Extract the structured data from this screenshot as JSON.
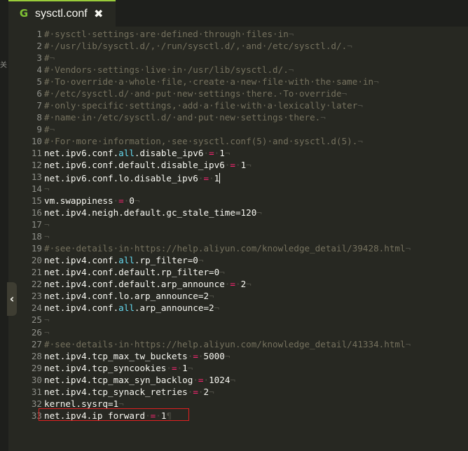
{
  "tab": {
    "title": "sysctl.conf",
    "icon": "G",
    "close": "✖"
  },
  "side_glyph": "关",
  "collapse_glyph": "‹",
  "colors": {
    "background": "#272822",
    "comment": "#75715e",
    "keyword": "#66d9ef",
    "operator": "#f92672",
    "text": "#f8f8f2",
    "highlight_border": "#e02020"
  },
  "lines": [
    {
      "n": "1",
      "tokens": [
        [
          "comment",
          "#·sysctl·settings·are·defined·through·files·in"
        ],
        [
          "ws",
          "¬"
        ]
      ]
    },
    {
      "n": "2",
      "tokens": [
        [
          "comment",
          "#·/usr/lib/sysctl.d/,·/run/sysctl.d/,·and·/etc/sysctl.d/."
        ],
        [
          "ws",
          "¬"
        ]
      ]
    },
    {
      "n": "3",
      "tokens": [
        [
          "comment",
          "#"
        ],
        [
          "ws",
          "¬"
        ]
      ]
    },
    {
      "n": "4",
      "tokens": [
        [
          "comment",
          "#·Vendors·settings·live·in·/usr/lib/sysctl.d/."
        ],
        [
          "ws",
          "¬"
        ]
      ]
    },
    {
      "n": "5",
      "tokens": [
        [
          "comment",
          "#·To·override·a·whole·file,·create·a·new·file·with·the·same·in"
        ],
        [
          "ws",
          "¬"
        ]
      ]
    },
    {
      "n": "6",
      "tokens": [
        [
          "comment",
          "#·/etc/sysctl.d/·and·put·new·settings·there.·To·override"
        ],
        [
          "ws",
          "¬"
        ]
      ]
    },
    {
      "n": "7",
      "tokens": [
        [
          "comment",
          "#·only·specific·settings,·add·a·file·with·a·lexically·later"
        ],
        [
          "ws",
          "¬"
        ]
      ]
    },
    {
      "n": "8",
      "tokens": [
        [
          "comment",
          "#·name·in·/etc/sysctl.d/·and·put·new·settings·there."
        ],
        [
          "ws",
          "¬"
        ]
      ]
    },
    {
      "n": "9",
      "tokens": [
        [
          "comment",
          "#"
        ],
        [
          "ws",
          "¬"
        ]
      ]
    },
    {
      "n": "10",
      "tokens": [
        [
          "comment",
          "#·For·more·information,·see·sysctl.conf(5)·and·sysctl.d(5)."
        ],
        [
          "ws",
          "¬"
        ]
      ]
    },
    {
      "n": "11",
      "tokens": [
        [
          "key",
          "net.ipv6.conf."
        ],
        [
          "kw",
          "all"
        ],
        [
          "key",
          ".disable_ipv6"
        ],
        [
          "ws",
          "·"
        ],
        [
          "op",
          "="
        ],
        [
          "ws",
          "·"
        ],
        [
          "num",
          "1"
        ],
        [
          "ws",
          "¬"
        ]
      ]
    },
    {
      "n": "12",
      "tokens": [
        [
          "key",
          "net.ipv6.conf.default.disable_ipv6"
        ],
        [
          "ws",
          "·"
        ],
        [
          "op",
          "="
        ],
        [
          "ws",
          "·"
        ],
        [
          "num",
          "1"
        ],
        [
          "ws",
          "¬"
        ]
      ]
    },
    {
      "n": "13",
      "tokens": [
        [
          "key",
          "net.ipv6.conf.lo.disable_ipv6"
        ],
        [
          "ws",
          "·"
        ],
        [
          "op",
          "="
        ],
        [
          "ws",
          "·"
        ],
        [
          "num",
          "1"
        ]
      ]
    },
    {
      "n": "14",
      "tokens": [
        [
          "ws",
          "¬"
        ]
      ]
    },
    {
      "n": "15",
      "tokens": [
        [
          "key",
          "vm.swappiness"
        ],
        [
          "ws",
          "·"
        ],
        [
          "op",
          "="
        ],
        [
          "ws",
          "·"
        ],
        [
          "num",
          "0"
        ],
        [
          "ws",
          "¬"
        ]
      ]
    },
    {
      "n": "16",
      "tokens": [
        [
          "key",
          "net.ipv4.neigh.default.gc_stale_time=120"
        ],
        [
          "ws",
          "¬"
        ]
      ]
    },
    {
      "n": "17",
      "tokens": [
        [
          "ws",
          "¬"
        ]
      ]
    },
    {
      "n": "18",
      "tokens": [
        [
          "ws",
          "¬"
        ]
      ]
    },
    {
      "n": "19",
      "tokens": [
        [
          "comment",
          "#·see·details·in·https://help.aliyun.com/knowledge_detail/39428.html"
        ],
        [
          "ws",
          "¬"
        ]
      ]
    },
    {
      "n": "20",
      "tokens": [
        [
          "key",
          "net.ipv4.conf."
        ],
        [
          "kw",
          "all"
        ],
        [
          "key",
          ".rp_filter=0"
        ],
        [
          "ws",
          "¬"
        ]
      ]
    },
    {
      "n": "21",
      "tokens": [
        [
          "key",
          "net.ipv4.conf.default.rp_filter=0"
        ],
        [
          "ws",
          "¬"
        ]
      ]
    },
    {
      "n": "22",
      "tokens": [
        [
          "key",
          "net.ipv4.conf.default.arp_announce"
        ],
        [
          "ws",
          "·"
        ],
        [
          "op",
          "="
        ],
        [
          "ws",
          "·"
        ],
        [
          "num",
          "2"
        ],
        [
          "ws",
          "¬"
        ]
      ]
    },
    {
      "n": "23",
      "tokens": [
        [
          "key",
          "net.ipv4.conf.lo.arp_announce=2"
        ],
        [
          "ws",
          "¬"
        ]
      ]
    },
    {
      "n": "24",
      "tokens": [
        [
          "key",
          "net.ipv4.conf."
        ],
        [
          "kw",
          "all"
        ],
        [
          "key",
          ".arp_announce=2"
        ],
        [
          "ws",
          "¬"
        ]
      ]
    },
    {
      "n": "25",
      "tokens": [
        [
          "ws",
          "¬"
        ]
      ]
    },
    {
      "n": "26",
      "tokens": [
        [
          "ws",
          "¬"
        ]
      ]
    },
    {
      "n": "27",
      "tokens": [
        [
          "comment",
          "#·see·details·in·https://help.aliyun.com/knowledge_detail/41334.html"
        ],
        [
          "ws",
          "¬"
        ]
      ]
    },
    {
      "n": "28",
      "tokens": [
        [
          "key",
          "net.ipv4.tcp_max_tw_buckets"
        ],
        [
          "ws",
          "·"
        ],
        [
          "op",
          "="
        ],
        [
          "ws",
          "·"
        ],
        [
          "num",
          "5000"
        ],
        [
          "ws",
          "¬"
        ]
      ]
    },
    {
      "n": "29",
      "tokens": [
        [
          "key",
          "net.ipv4.tcp_syncookies"
        ],
        [
          "ws",
          "·"
        ],
        [
          "op",
          "="
        ],
        [
          "ws",
          "·"
        ],
        [
          "num",
          "1"
        ],
        [
          "ws",
          "¬"
        ]
      ]
    },
    {
      "n": "30",
      "tokens": [
        [
          "key",
          "net.ipv4.tcp_max_syn_backlog"
        ],
        [
          "ws",
          "·"
        ],
        [
          "op",
          "="
        ],
        [
          "ws",
          "·"
        ],
        [
          "num",
          "1024"
        ],
        [
          "ws",
          "¬"
        ]
      ]
    },
    {
      "n": "31",
      "tokens": [
        [
          "key",
          "net.ipv4.tcp_synack_retries"
        ],
        [
          "ws",
          "·"
        ],
        [
          "op",
          "="
        ],
        [
          "ws",
          "·"
        ],
        [
          "num",
          "2"
        ],
        [
          "ws",
          "¬"
        ]
      ]
    },
    {
      "n": "32",
      "tokens": [
        [
          "key",
          "kernel.sysrq=1"
        ],
        [
          "ws",
          "¬"
        ]
      ]
    },
    {
      "n": "33",
      "tokens": [
        [
          "key",
          "net.ipv4.ip_forward"
        ],
        [
          "ws",
          "·"
        ],
        [
          "op",
          "="
        ],
        [
          "ws",
          "·"
        ],
        [
          "num",
          "1"
        ],
        [
          "ws",
          "¶"
        ]
      ]
    }
  ]
}
